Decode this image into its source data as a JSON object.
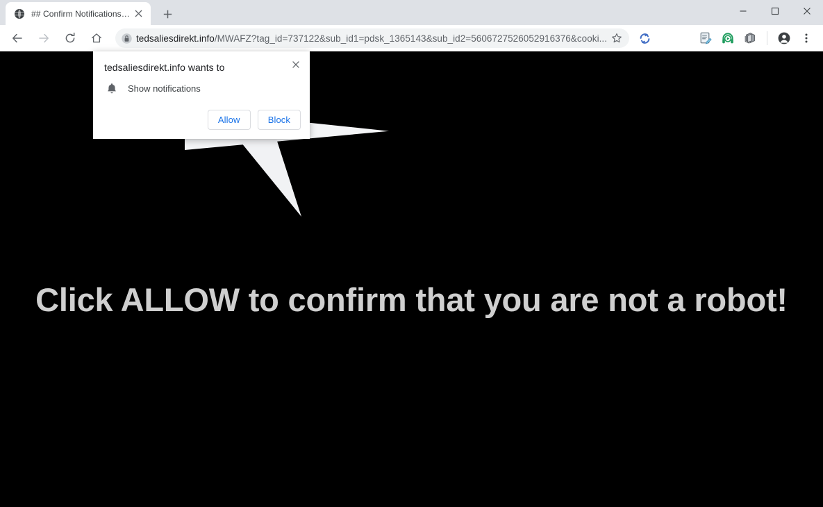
{
  "window": {
    "controls": [
      {
        "name": "minimize",
        "glyph": "—"
      },
      {
        "name": "maximize",
        "glyph": "□"
      },
      {
        "name": "close",
        "glyph": "✕"
      }
    ]
  },
  "tabstrip": {
    "tab": {
      "title": "## Confirm Notifications ##",
      "favicon": "globe-icon",
      "close_glyph": "✕"
    },
    "new_tab_glyph": "+",
    "new_tab_label": "New Tab"
  },
  "toolbar": {
    "back_label": "Back",
    "forward_label": "Forward",
    "reload_label": "Reload",
    "home_label": "Home",
    "lock_icon": "lock-icon",
    "url_host": "tedsaliesdirekt.info",
    "url_path": "/MWAFZ?tag_id=737122&sub_id1=pdsk_1365143&sub_id2=5606727526052916376&cooki...",
    "url_full": "tedsaliesdirekt.info/MWAFZ?tag_id=737122&sub_id1=pdsk_1365143&sub_id2=5606727526052916376&cooki...",
    "bookmark_label": "Bookmark this page",
    "extensions": [
      {
        "name": "sync-refresh-icon",
        "color": "#3f6cc4",
        "label": "Sync"
      },
      {
        "name": "note-edit-icon",
        "color": "#5f6368",
        "label": "Notes"
      },
      {
        "name": "headphone-play-icon",
        "color": "#1f9d5e",
        "label": "Audio player"
      },
      {
        "name": "stacked-pages-icon",
        "color": "#6b6b6b",
        "label": "Pages"
      }
    ],
    "profile_label": "Profile",
    "menu_label": "Customize and control Google Chrome",
    "menu_glyph": "⋮"
  },
  "permission_dialog": {
    "title": "tedsaliesdirekt.info wants to",
    "permission_icon": "bell-icon",
    "permission_label": "Show notifications",
    "allow_label": "Allow",
    "block_label": "Block",
    "close_glyph": "✕",
    "accent_color": "#1a73e8"
  },
  "page": {
    "background_color": "#000000",
    "headline": "Click ALLOW to confirm that you are not a robot!",
    "headline_color": "#cfcfcf",
    "artwork": [
      {
        "name": "callout-tail-right",
        "color": "#f4f5f7"
      },
      {
        "name": "callout-tail-down",
        "color": "#f1f2f4"
      }
    ]
  }
}
